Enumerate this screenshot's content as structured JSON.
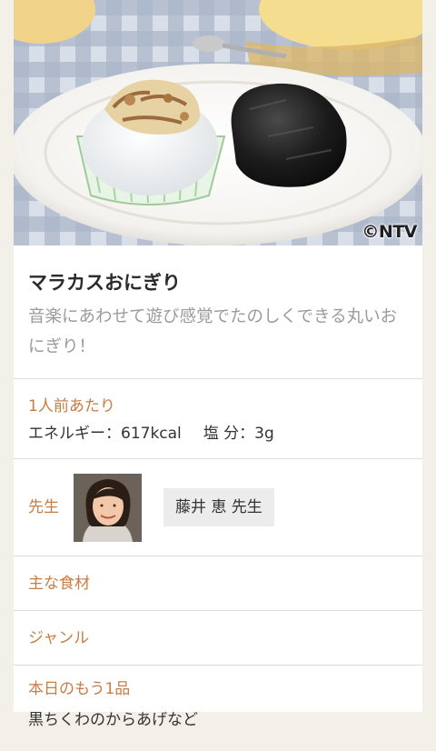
{
  "hero": {
    "watermark": "©NTV",
    "alt": "マラカスおにぎり"
  },
  "recipe": {
    "title": "マラカスおにぎり",
    "description": "音楽にあわせて遊び感覚でたのしくできる丸いおにぎり！"
  },
  "nutrition": {
    "label": "1人前あたり",
    "energy": "エネルギー：617kcal",
    "salt": "塩 分：3g"
  },
  "teacher": {
    "label": "先生",
    "name": "藤井 恵 先生"
  },
  "ingredients": {
    "label": "主な食材"
  },
  "genre": {
    "label": "ジャンル"
  },
  "more": {
    "label": "本日のもう1品",
    "item": "黒ちくわのからあげなど"
  },
  "colors": {
    "accent": "#c87d45",
    "background": "#f3f0ea"
  }
}
